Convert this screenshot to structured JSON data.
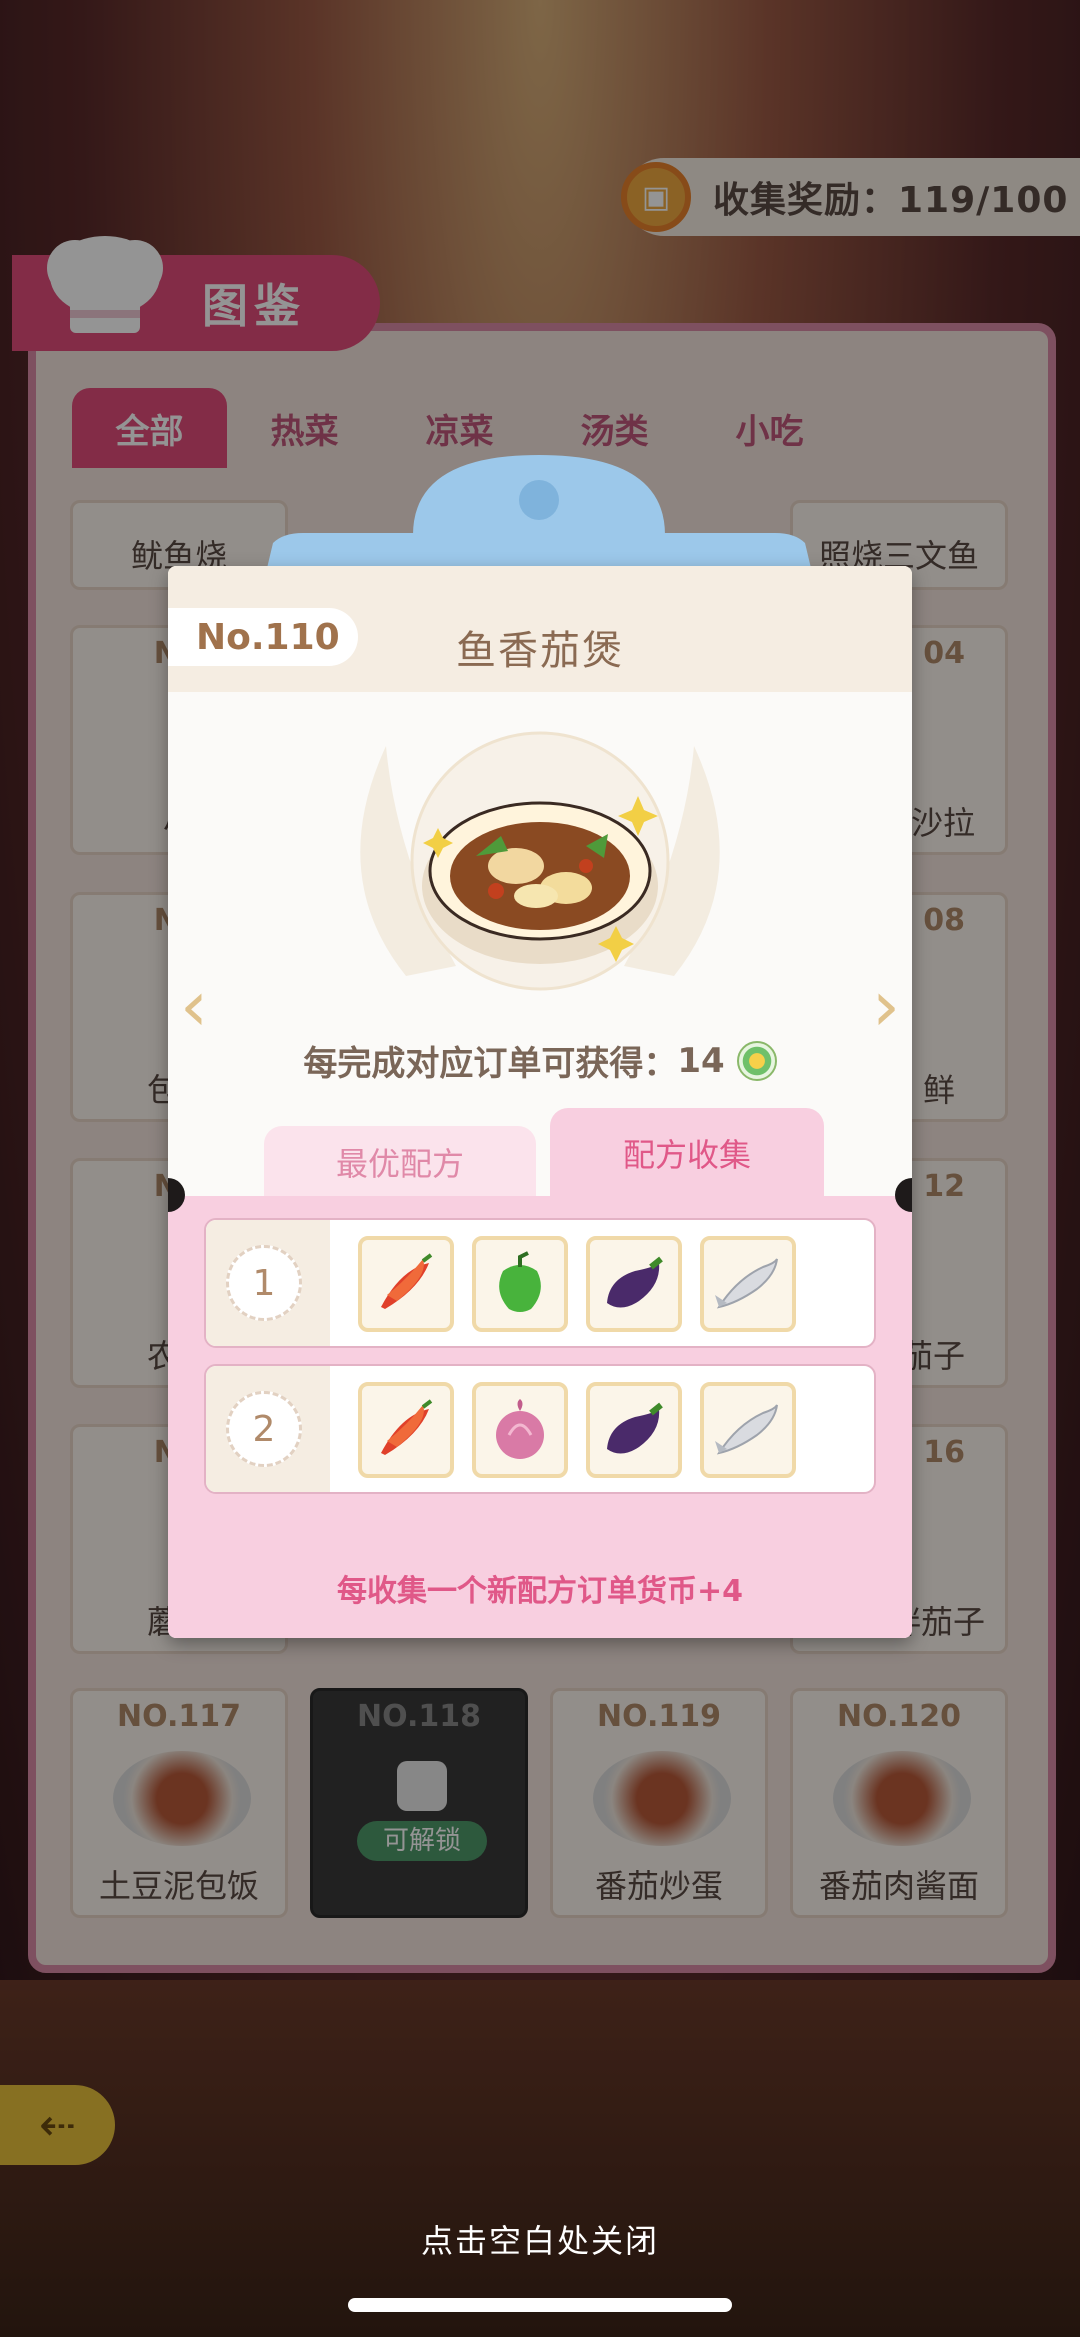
{
  "header": {
    "reward_text": "收集奖励：119/100",
    "title": "图鉴"
  },
  "catalog": {
    "tabs": [
      "全部",
      "热菜",
      "凉菜",
      "汤类",
      "小吃"
    ],
    "visible_names": [
      "鱿鱼烧",
      "照烧三文鱼",
      "NO",
      "04",
      "小",
      "沙拉",
      "NO",
      "08",
      "包菜",
      "鲜",
      "NO",
      "12",
      "农家",
      "茄子",
      "NO",
      "16",
      "蘑菇",
      "拌茄子"
    ],
    "bottom_cards": [
      {
        "no": "NO.117",
        "name": "土豆泥包饭"
      },
      {
        "no": "NO.118",
        "name": "",
        "badge": "可解锁"
      },
      {
        "no": "NO.119",
        "name": "番茄炒蛋"
      },
      {
        "no": "NO.120",
        "name": "番茄肉酱面"
      }
    ]
  },
  "modal": {
    "number": "No.110",
    "dish_name": "鱼香茄煲",
    "reward_prefix": "每完成对应订单可获得：",
    "reward_value": "14",
    "tab_optimal": "最优配方",
    "tab_collect": "配方收集",
    "recipes": [
      {
        "index": "1",
        "ingredients": [
          "chili-pepper",
          "green-pepper",
          "eggplant",
          "fish"
        ]
      },
      {
        "index": "2",
        "ingredients": [
          "chili-pepper",
          "onion",
          "eggplant",
          "fish"
        ]
      }
    ],
    "footer_note": "每收集一个新配方订单货币+4"
  },
  "close_hint": "点击空白处关闭",
  "colors": {
    "accent_pink": "#e24d7a",
    "collect_tab_pink": "#f8cfe0",
    "label_brown": "#8a6a52"
  }
}
